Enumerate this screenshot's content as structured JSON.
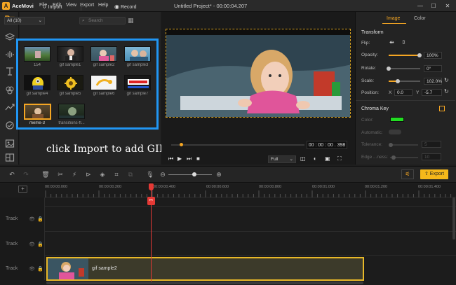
{
  "app": {
    "name": "AceMovi",
    "window_title": "Untitled Project* - 00:00:04.207",
    "menu": [
      "File",
      "Edit",
      "View",
      "Export",
      "Help"
    ]
  },
  "media": {
    "import_label": "Import",
    "record_label": "Record",
    "filter_value": "All (10)",
    "search_placeholder": "Search",
    "items": [
      {
        "label": "154"
      },
      {
        "label": "gif sample1"
      },
      {
        "label": "gif sample2"
      },
      {
        "label": "gif sample3"
      },
      {
        "label": "gif sample4"
      },
      {
        "label": "gif sample5"
      },
      {
        "label": "gif sample6"
      },
      {
        "label": "gif sample7"
      },
      {
        "label": "meme-3"
      },
      {
        "label": "transitions-fl..."
      }
    ]
  },
  "caption": "click Import to add GIFs",
  "preview": {
    "timecode": "00 : 00 : 00 . 398",
    "quality": "Full",
    "progress": 0.06
  },
  "properties": {
    "tabs": [
      "Image",
      "Color"
    ],
    "transform_title": "Transform",
    "flip_label": "Flip:",
    "opacity_label": "Opacity:",
    "opacity_value": "100%",
    "opacity_level": 1.0,
    "rotate_label": "Rotate:",
    "rotate_value": "0°",
    "scale_label": "Scale:",
    "scale_value": "102.0%",
    "position_label": "Position:",
    "pos_x_label": "X",
    "pos_x_value": "0.0",
    "pos_y_label": "Y",
    "pos_y_value": "-5.7",
    "chroma_title": "Chroma Key",
    "color_label": "Color:",
    "color_value": "#22dd22",
    "automatic_label": "Automatic:",
    "tolerance_label": "Tolerance:",
    "tolerance_value": "5",
    "edge_label": "Edge ...ness:",
    "edge_value": "10"
  },
  "toolbar": {
    "export_label": "Export"
  },
  "timeline": {
    "ticks": [
      "00:00:00.000",
      "00:00:00.200",
      "00:00:00.400",
      "00:00:00.600",
      "00:00:00.800",
      "00:00:01.000",
      "00:00:01.200",
      "00:00:01.400"
    ],
    "tracks": [
      "Track",
      "Track",
      "Track"
    ],
    "clip_label": "gif sample2"
  },
  "colors": {
    "accent": "#f5a623",
    "highlight": "#2196f3",
    "playhead": "#e53935"
  }
}
